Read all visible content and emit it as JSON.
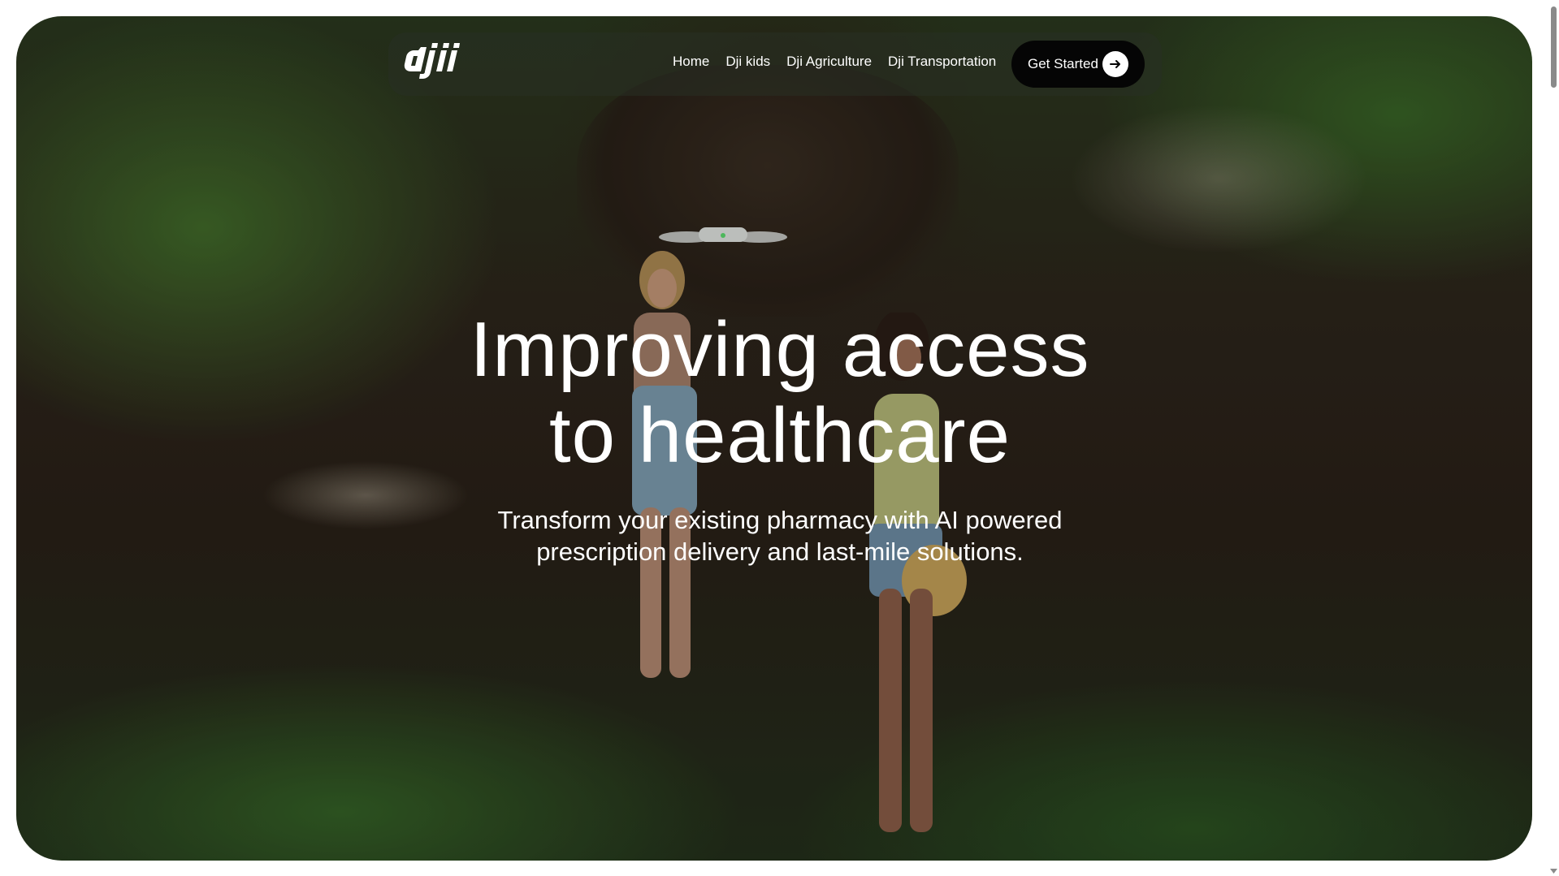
{
  "nav": {
    "logo_text": "dji",
    "links": [
      {
        "label": "Home"
      },
      {
        "label": "Dji kids"
      },
      {
        "label": "Dji Agriculture"
      },
      {
        "label": "Dji Transportation"
      }
    ],
    "cta_label": "Get Started",
    "cta_icon": "arrow-right-icon"
  },
  "hero": {
    "headline_line1": "Improving access",
    "headline_line2": "to healthcare",
    "subhead_line1": "Transform your existing pharmacy with AI powered",
    "subhead_line2": "prescription delivery and last-mile solutions.",
    "background": "forest scene with drone and two people"
  },
  "colors": {
    "cta_background": "#050505",
    "text": "#ffffff",
    "nav_background": "#28302499"
  }
}
